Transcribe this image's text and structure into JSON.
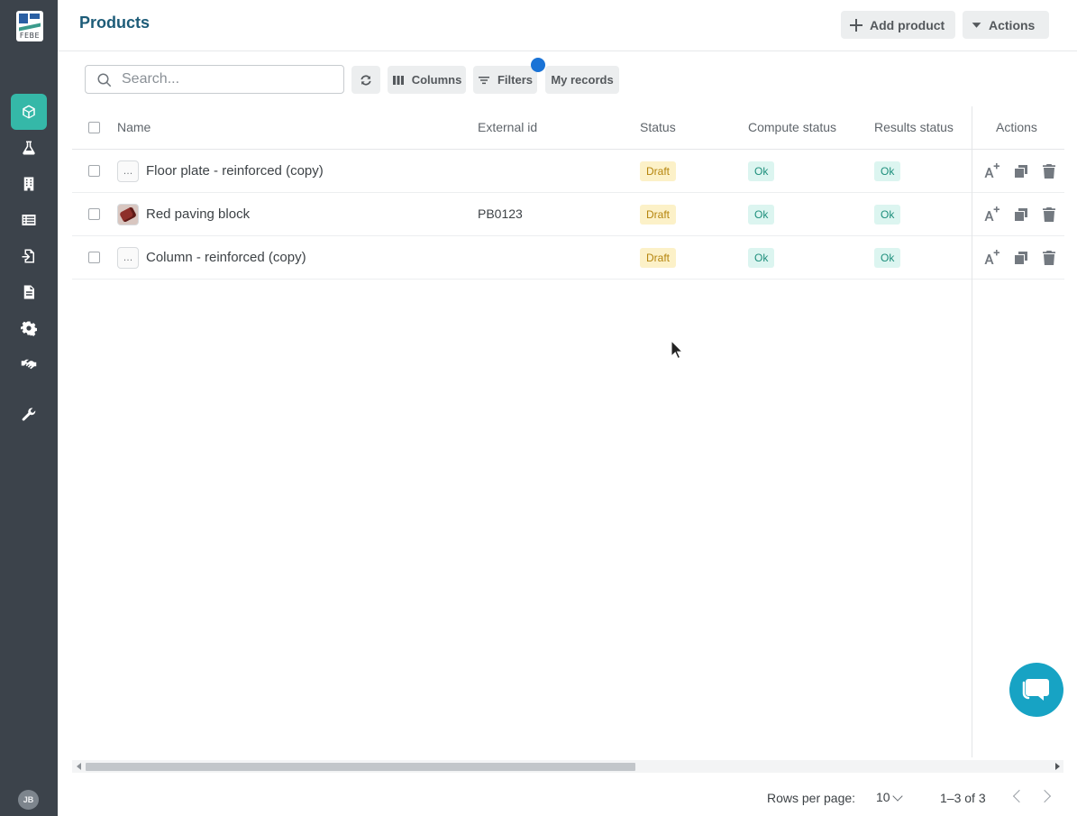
{
  "app": {
    "logo_text": "FEBE",
    "user_initials": "JB"
  },
  "sidebar": {
    "items": [
      {
        "icon": "cube-icon",
        "active": true
      },
      {
        "icon": "flask-icon",
        "active": false
      },
      {
        "icon": "building-icon",
        "active": false
      },
      {
        "icon": "list-icon",
        "active": false
      },
      {
        "icon": "import-icon",
        "active": false
      },
      {
        "icon": "document-icon",
        "active": false
      },
      {
        "icon": "gear-icon",
        "active": false
      },
      {
        "icon": "handshake-icon",
        "active": false
      },
      {
        "icon": "wrench-icon",
        "active": false
      }
    ]
  },
  "header": {
    "title": "Products",
    "add_label": "Add product",
    "actions_label": "Actions"
  },
  "toolbar": {
    "search_placeholder": "Search...",
    "columns_label": "Columns",
    "filters_label": "Filters",
    "my_records_label": "My records"
  },
  "table": {
    "columns": {
      "name": "Name",
      "external_id": "External id",
      "status": "Status",
      "compute_status": "Compute status",
      "results_status": "Results status",
      "actions": "Actions"
    },
    "rows": [
      {
        "name": "Floor plate - reinforced (copy)",
        "external_id": "",
        "status": "Draft",
        "compute_status": "Ok",
        "results_status": "Ok",
        "thumb": "…"
      },
      {
        "name": "Red paving block",
        "external_id": "PB0123",
        "status": "Draft",
        "compute_status": "Ok",
        "results_status": "Ok",
        "thumb": ""
      },
      {
        "name": "Column - reinforced (copy)",
        "external_id": "",
        "status": "Draft",
        "compute_status": "Ok",
        "results_status": "Ok",
        "thumb": "…"
      }
    ]
  },
  "pagination": {
    "rows_per_page_label": "Rows per page:",
    "rows_per_page": "10",
    "range": "1–3 of 3"
  },
  "colors": {
    "sidebar_bg": "#3c434b",
    "accent": "#35b8a8",
    "title": "#1d5c78",
    "filter_dot": "#1a73d6",
    "chat": "#17a3c4"
  }
}
